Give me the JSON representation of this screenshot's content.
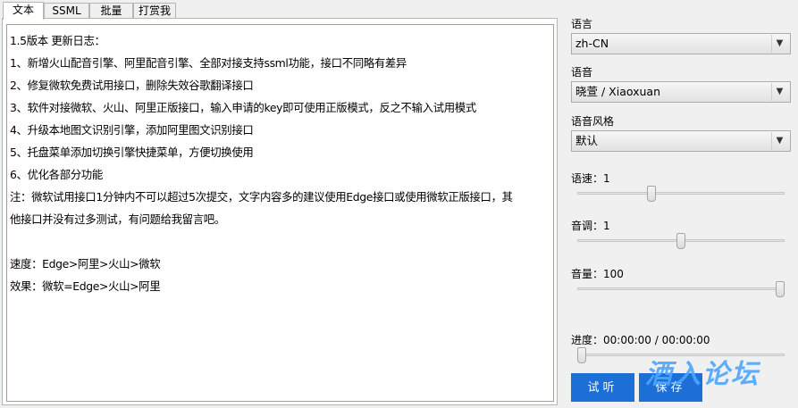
{
  "tabs": [
    "文本",
    "SSML",
    "批量",
    "打赏我"
  ],
  "editor": {
    "lines": [
      "1.5版本 更新日志：",
      "1、新增火山配音引擎、阿里配音引擎、全部对接支持ssml功能，接口不同略有差异",
      "2、修复微软免费试用接口，删除失效谷歌翻译接口",
      "3、软件对接微软、火山、阿里正版接口，输入申请的key即可使用正版模式，反之不输入试用模式",
      "4、升级本地图文识别引擎，添加阿里图文识别接口",
      "5、托盘菜单添加切换引擎快捷菜单，方便切换使用",
      "6、优化各部分功能",
      "注：微软试用接口1分钟内不可以超过5次提交，文字内容多的建议使用Edge接口或使用微软正版接口，其",
      "他接口并没有过多测试，有问题给我留言吧。",
      "",
      "速度：Edge>阿里>火山>微软",
      "效果：微软=Edge>火山>阿里"
    ]
  },
  "panel": {
    "language_label": "语言",
    "language_value": "zh-CN",
    "voice_label": "语音",
    "voice_value": "晓萱 / Xiaoxuan",
    "style_label": "语音风格",
    "style_value": "默认",
    "speed_label": "语速：1",
    "speed_level": 0.35,
    "pitch_label": "音调：1",
    "pitch_level": 0.5,
    "volume_label": "音量：100",
    "volume_level": 1.0,
    "progress_label": "进度：00:00:00 / 00:00:00",
    "progress_level": 0.0
  },
  "buttons": {
    "listen": "试听",
    "save": "保存"
  },
  "watermark": "酒入论坛",
  "colors": {
    "button_bg": "#1c6fd6",
    "editor_border": "#7aa7d6"
  }
}
